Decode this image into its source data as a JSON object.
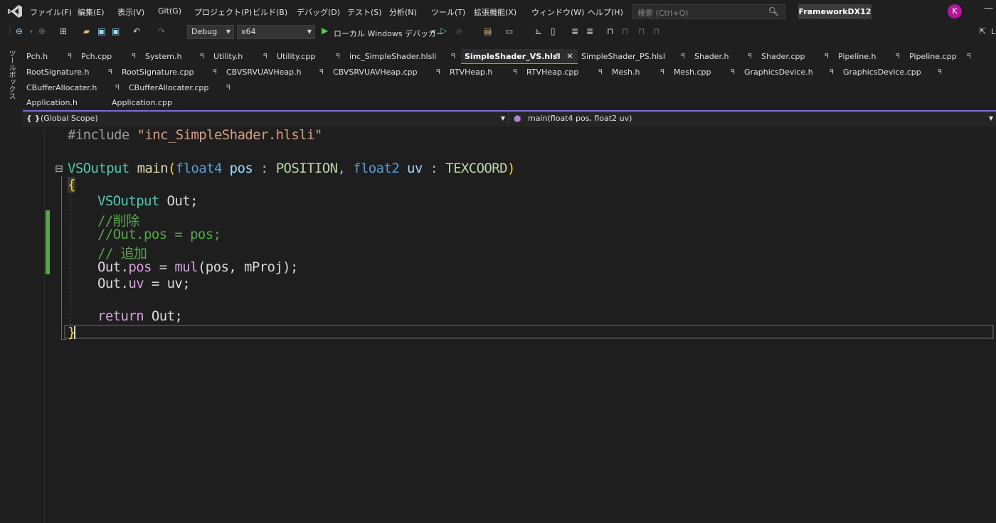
{
  "menu": {
    "items": [
      "ファイル(F)",
      "編集(E)",
      "表示(V)",
      "Git(G)",
      "プロジェクト(P)",
      "ビルド(B)",
      "デバッグ(D)",
      "テスト(S)",
      "分析(N)",
      "ツール(T)",
      "拡張機能(X)",
      "ウィンドウ(W)",
      "ヘルプ(H)"
    ],
    "search_placeholder": "検索 (Ctrl+Q)",
    "solution_name": "FrameworkDX12",
    "avatar_initial": "K"
  },
  "toolbar": {
    "configuration": "Debug",
    "platform": "x64",
    "debugger_label": "ローカル Windows デバッガー",
    "live_share": "L"
  },
  "toolbox": {
    "label": "ツールボックス"
  },
  "tabs": {
    "row1": [
      {
        "label": "Pch.h"
      },
      {
        "label": "Pch.cpp"
      },
      {
        "label": "System.h"
      },
      {
        "label": "Utility.h"
      },
      {
        "label": "Utility.cpp"
      },
      {
        "label": "inc_SimpleShader.hlsli"
      },
      {
        "label": "SimpleShader_VS.hlsl",
        "active": true
      },
      {
        "label": "SimpleShader_PS.hlsl"
      },
      {
        "label": "Shader.h"
      },
      {
        "label": "Shader.cpp"
      },
      {
        "label": "Pipeline.h"
      },
      {
        "label": "Pipeline.cpp"
      }
    ],
    "row2": [
      {
        "label": "RootSignature.h"
      },
      {
        "label": "RootSignature.cpp"
      },
      {
        "label": "CBVSRVUAVHeap.h"
      },
      {
        "label": "CBVSRVUAVHeap.cpp"
      },
      {
        "label": "RTVHeap.h"
      },
      {
        "label": "RTVHeap.cpp"
      },
      {
        "label": "Mesh.h"
      },
      {
        "label": "Mesh.cpp"
      },
      {
        "label": "GraphicsDevice.h"
      },
      {
        "label": "GraphicsDevice.cpp"
      }
    ],
    "row3": [
      {
        "label": "CBufferAllocater.h"
      },
      {
        "label": "CBufferAllocater.cpp"
      }
    ],
    "row4": [
      {
        "label": "Application.h"
      },
      {
        "label": "Application.cpp"
      }
    ]
  },
  "navbar": {
    "scope": "(Global Scope)",
    "member": "main(float4 pos, float2 uv)"
  },
  "code": {
    "include_kw": "#include",
    "include_file": "\"inc_SimpleShader.hlsli\"",
    "fn_ret_type": "VSOutput",
    "fn_name": "main",
    "fn_paren_open": "(",
    "p1_type": "float4",
    "p1_name": "pos",
    "colon": ":",
    "p1_sem": "POSITION",
    "comma": ",",
    "p2_type": "float2",
    "p2_name": "uv",
    "p2_sem": "TEXCOORD",
    "fn_paren_close": ")",
    "brace_open": "{",
    "decl_type": "VSOutput",
    "decl_rest": " Out;",
    "comment1": "//削除",
    "comment2": "//Out.pos = pos;",
    "comment3": "// 追加",
    "assign1_lhs_obj": "Out.",
    "assign1_lhs_mem": "pos",
    "assign1_eq": " = ",
    "assign1_fn": "mul",
    "assign1_args": "(pos, mProj)",
    "assign1_end": ";",
    "assign2_lhs_obj": "Out.",
    "assign2_lhs_mem": "uv",
    "assign2_rest": " = uv;",
    "return_kw": "return",
    "return_rest": " Out;",
    "brace_close": "}"
  }
}
